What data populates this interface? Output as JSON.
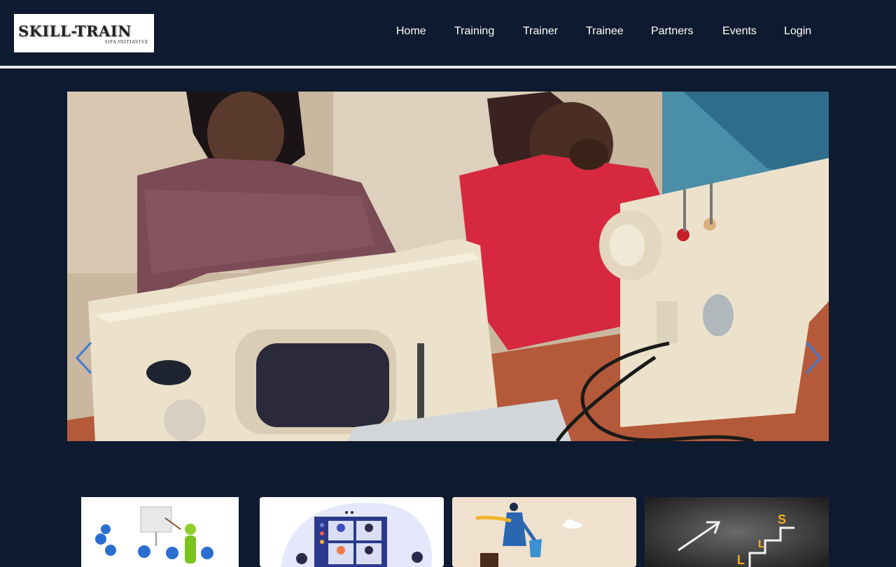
{
  "brand": {
    "name": "SKILL-TRAIN",
    "tagline": "SIFA INITIAVIVE"
  },
  "nav": {
    "items": [
      {
        "label": "Home"
      },
      {
        "label": "Training"
      },
      {
        "label": "Trainer"
      },
      {
        "label": "Trainee"
      },
      {
        "label": "Partners"
      },
      {
        "label": "Events"
      },
      {
        "label": "Login"
      }
    ]
  },
  "carousel": {
    "prev_icon": "chevron-left-icon",
    "next_icon": "chevron-right-icon",
    "slide_subject": "women-at-sewing-machines-photo"
  },
  "cards": [
    {
      "name": "card-presentation-illustration"
    },
    {
      "name": "card-video-conference-illustration"
    },
    {
      "name": "card-businessman-illustration"
    },
    {
      "name": "card-chalkboard-skills-illustration"
    }
  ],
  "colors": {
    "background": "#0e1a2f",
    "nav_text": "#ffffff",
    "divider": "#e6e8ec",
    "arrow": "#3d7bd6"
  }
}
